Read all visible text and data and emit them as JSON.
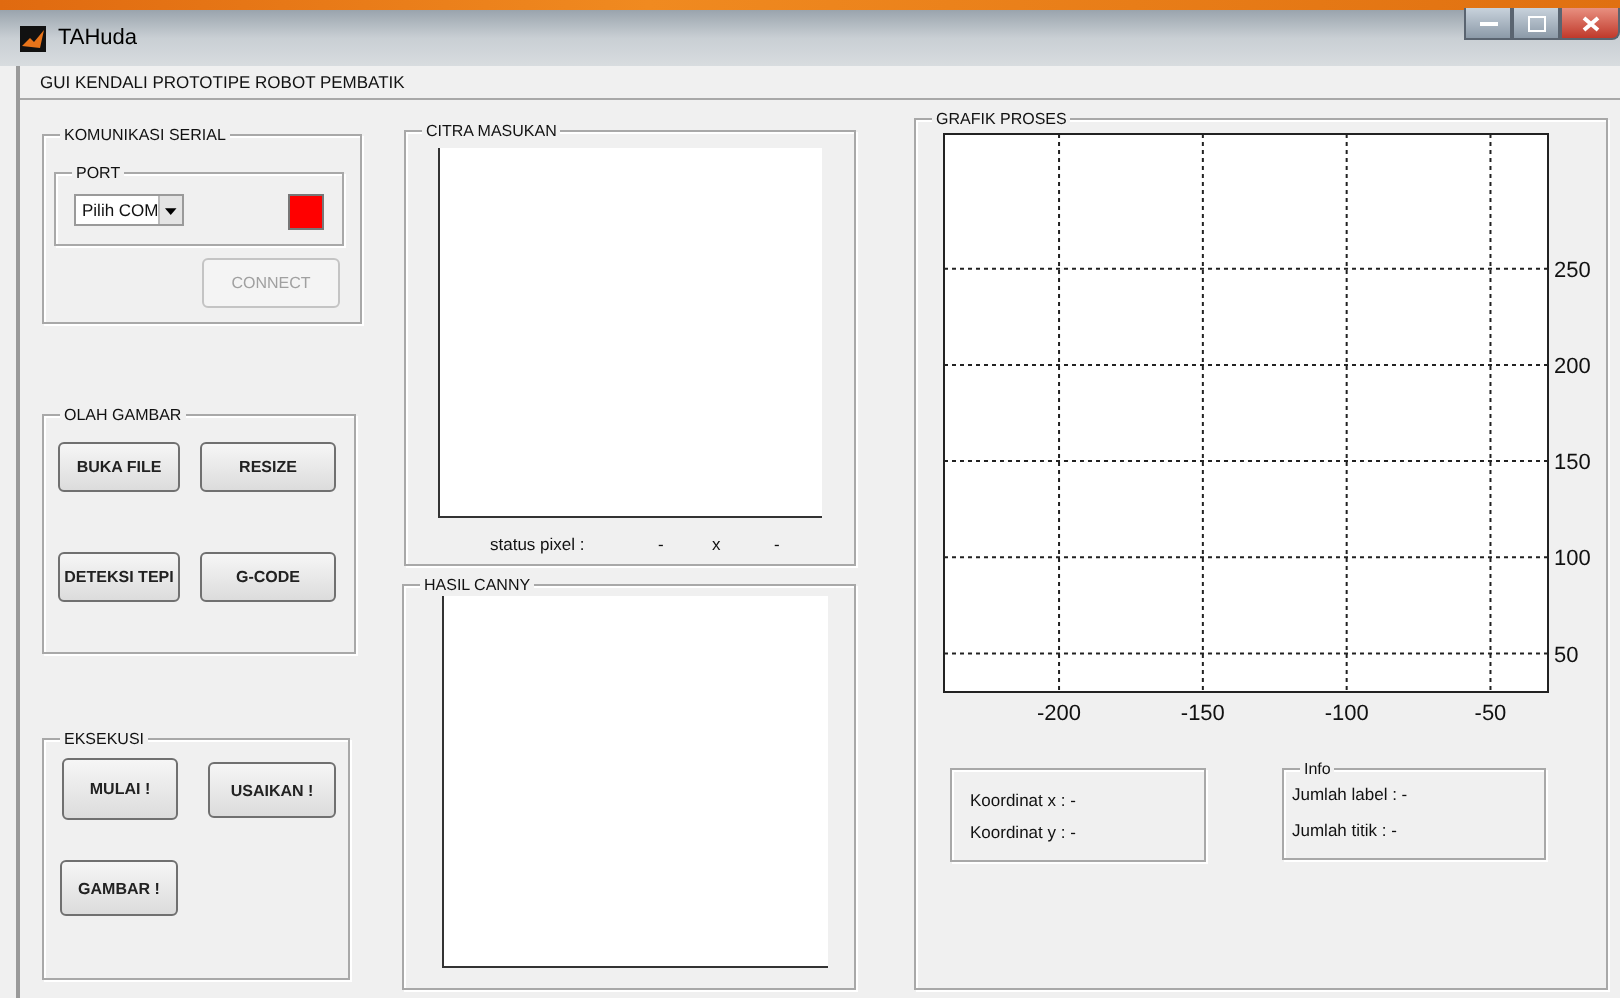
{
  "window": {
    "title": "TAHuda"
  },
  "header": {
    "title": "GUI KENDALI PROTOTIPE ROBOT PEMBATIK"
  },
  "serial": {
    "title": "KOMUNIKASI SERIAL",
    "port": {
      "title": "PORT",
      "dropdown": "Pilih COM",
      "color": "#ff0000"
    },
    "connect": {
      "label": "CONNECT",
      "disabled": true
    }
  },
  "olah_gambar": {
    "title": "OLAH GAMBAR",
    "buttons": [
      {
        "label": "BUKA FILE",
        "disabled": false
      },
      {
        "label": "RESIZE",
        "disabled": false
      },
      {
        "label": "DETEKSI TEPI",
        "disabled": false
      },
      {
        "label": "G-CODE",
        "disabled": false
      }
    ]
  },
  "eksekusi": {
    "title": "EKSEKUSI",
    "buttons": [
      {
        "label": "MULAI !",
        "disabled": false
      },
      {
        "label": "USAIKAN !",
        "disabled": false
      },
      {
        "label": "GAMBAR !",
        "disabled": false
      }
    ]
  },
  "citra_masukan": {
    "title": "CITRA MASUKAN",
    "status_label": "status pixel :",
    "status_x": "-",
    "separator": "x",
    "status_y": "-"
  },
  "hasil_canny": {
    "title": "HASIL CANNY"
  },
  "grafik": {
    "title": "GRAFIK PROSES",
    "chart_data": {
      "type": "line",
      "grid": true,
      "xlim": [
        -240,
        -30
      ],
      "ylim": [
        30,
        320
      ],
      "xticks": [
        -200,
        -150,
        -100,
        -50
      ],
      "yticks": [
        50,
        100,
        150,
        200,
        250
      ]
    },
    "koordinat": [
      "Koordinat x : -",
      "Koordinat y : -"
    ],
    "info": {
      "title": "Info",
      "lines": [
        "Jumlah label : -",
        "Jumlah titik : -"
      ]
    }
  }
}
